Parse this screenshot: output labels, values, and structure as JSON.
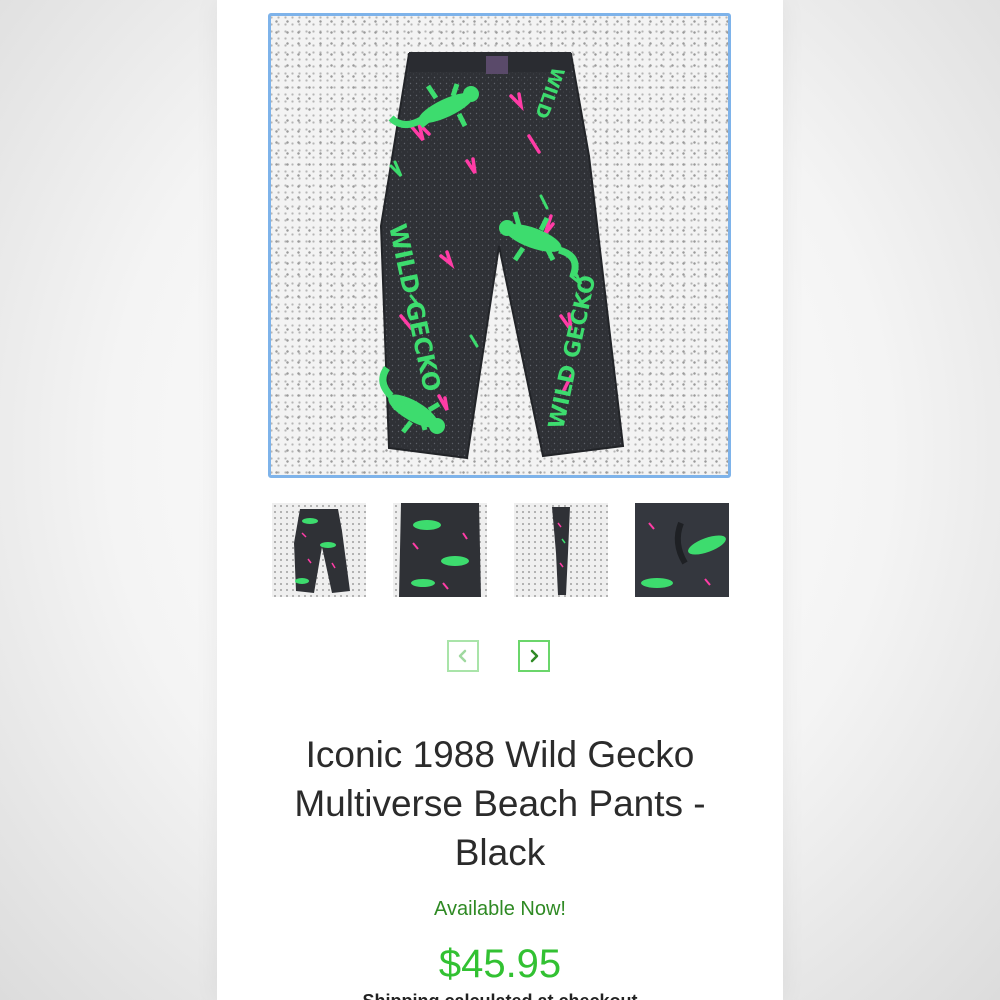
{
  "product": {
    "title_line1": "Iconic 1988 Wild Gecko",
    "title_line2": "Multiverse Beach Pants -",
    "title_line3": "Black",
    "availability": "Available Now!",
    "price": "$45.95",
    "shipping_note": "Shipping calculated at checkout"
  },
  "hero_image": {
    "pants_text_left": "WILD GECKO",
    "pants_text_right": "WILD GECKO",
    "waist_text": "WILD"
  },
  "gallery": {
    "thumbnails": [
      {
        "id": "front-view"
      },
      {
        "id": "back-view"
      },
      {
        "id": "side-view"
      },
      {
        "id": "detail-view"
      }
    ],
    "prev_icon": "chevron-left-icon",
    "next_icon": "chevron-right-icon"
  },
  "colors": {
    "hero_border": "#7eb3ea",
    "nav_border": "#6bd66b",
    "availability": "#2f8a24",
    "price": "#32c132",
    "gecko_green": "#3ddc6e",
    "neon_pink": "#ff3ca6"
  }
}
